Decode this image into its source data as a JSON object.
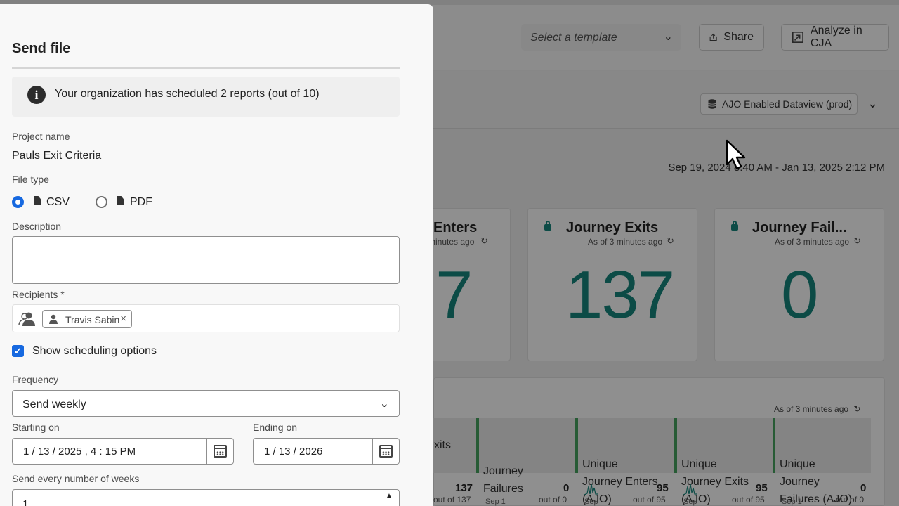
{
  "header": {
    "template_placeholder": "Select a template",
    "share_label": "Share",
    "analyze_label": "Analyze in CJA"
  },
  "dataview": {
    "label": "AJO Enabled Dataview (prod)"
  },
  "date_range": "Sep 19, 2024 8:40 AM - Jan 13, 2025 2:12 PM",
  "kpis": [
    {
      "title": "Enters",
      "asof": "minutes ago",
      "value": "7"
    },
    {
      "title": "Journey Exits",
      "asof": "As of 3 minutes ago",
      "value": "137"
    },
    {
      "title": "Journey Fail...",
      "asof": "As of 3 minutes ago",
      "value": "0"
    }
  ],
  "table": {
    "asof": "As of 3 minutes ago",
    "columns": [
      {
        "label": "xits"
      },
      {
        "label": "Journey\nFailures"
      },
      {
        "label": "Unique\nJourney Enters\n(AJO)"
      },
      {
        "label": "Unique\nJourney Exits\n(AJO)"
      },
      {
        "label": "Unique\nJourney\nFailures (AJO)"
      }
    ],
    "totals": [
      {
        "num": "137",
        "outof": "out of 137"
      },
      {
        "num": "0",
        "outof": "out of 0",
        "spark": "Sep 1"
      },
      {
        "num": "95",
        "outof": "out of 95",
        "spark": "Sep"
      },
      {
        "num": "95",
        "outof": "out of 95",
        "spark": "Sep"
      },
      {
        "num": "0",
        "outof": "out of 0",
        "spark": "Sep 1"
      }
    ]
  },
  "drawer": {
    "title": "Send file",
    "notice": "Your organization has scheduled 2 reports (out of 10)",
    "project_name_label": "Project name",
    "project_name": "Pauls Exit Criteria",
    "file_type_label": "File type",
    "file_types": [
      {
        "label": "CSV",
        "selected": true
      },
      {
        "label": "PDF",
        "selected": false
      }
    ],
    "description_label": "Description",
    "description_value": "",
    "recipients_label": "Recipients",
    "required_mark": "*",
    "recipients": [
      "Travis Sabin"
    ],
    "tag_remove": "×",
    "show_scheduling_label": "Show scheduling options",
    "show_scheduling_checked": true,
    "frequency_label": "Frequency",
    "frequency_value": "Send weekly",
    "starting_on_label": "Starting on",
    "starting_on_value": "1 / 13 / 2025 ,  4 : 15  PM",
    "ending_on_label": "Ending on",
    "ending_on_value": "1 / 13 / 2026",
    "weeks_label": "Send every number of weeks",
    "weeks_value": "1"
  },
  "colors": {
    "accent": "#1769e0",
    "metric": "#16877d",
    "series_bar": "#47a35f"
  }
}
